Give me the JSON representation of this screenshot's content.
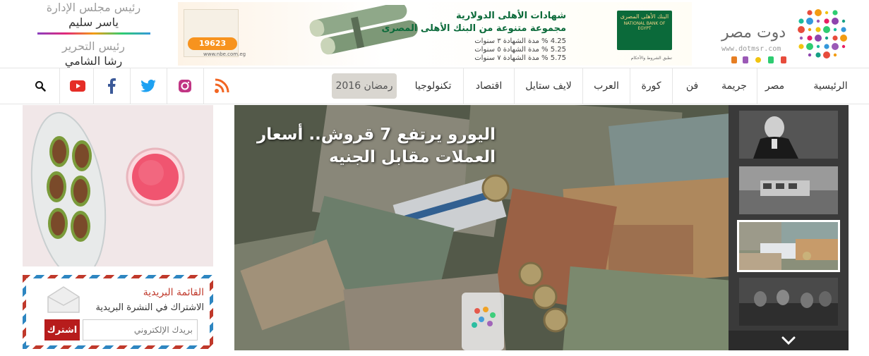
{
  "header": {
    "logo_text": "دوت مصر",
    "logo_url": "www.dotmsr.com",
    "editors": {
      "chair_title": "رئيس مجلس الإدارة",
      "chair_name": "ياسر سليم",
      "editor_title": "رئيس التحرير",
      "editor_name": "رشا الشامي"
    }
  },
  "ad": {
    "title1": "شهادات الأهلى الدولارية",
    "title2": "مجموعة متنوعة من البنك الأهلى المصرى",
    "rate1": "4.25 % مدة الشهادة ٣ سنوات",
    "rate2": "5.25 % مدة الشهادة ٥ سنوات",
    "rate3": "5.75 % مدة الشهادة ٧ سنوات",
    "phone": "19623",
    "web": "www.nbe.com.eg",
    "bank_ar": "البنك الأهلى المصرى",
    "bank_en": "NATIONAL BANK OF EGYPT",
    "note": "تطبق الشروط والأحكام"
  },
  "nav": {
    "items": [
      "الرئيسية",
      "مصر",
      "جريمة",
      "فن",
      "كورة",
      "العرب",
      "لايف ستايل",
      "اقتصاد",
      "تكنولوجيا"
    ],
    "ramadan": "رمضان 2016"
  },
  "icons": {
    "rss": "rss-icon",
    "instagram": "instagram-icon",
    "twitter": "twitter-icon",
    "facebook": "facebook-icon",
    "youtube": "youtube-icon",
    "search": "search-icon"
  },
  "hero": {
    "title": "اليورو يرتفع 7 قروش.. أسعار العملات مقابل الجنيه"
  },
  "newsletter": {
    "title": "القائمة البريدية",
    "subtitle": "الاشتراك في النشرة البريدية",
    "placeholder": "بريدك الإلكتروني",
    "button": "اشترك"
  },
  "colors": {
    "brand_green": "#0b6a3a",
    "accent_red": "#b71c1c",
    "rss": "#f26522",
    "twitter": "#1da1f2",
    "facebook": "#3b5998",
    "youtube": "#e52d27"
  }
}
